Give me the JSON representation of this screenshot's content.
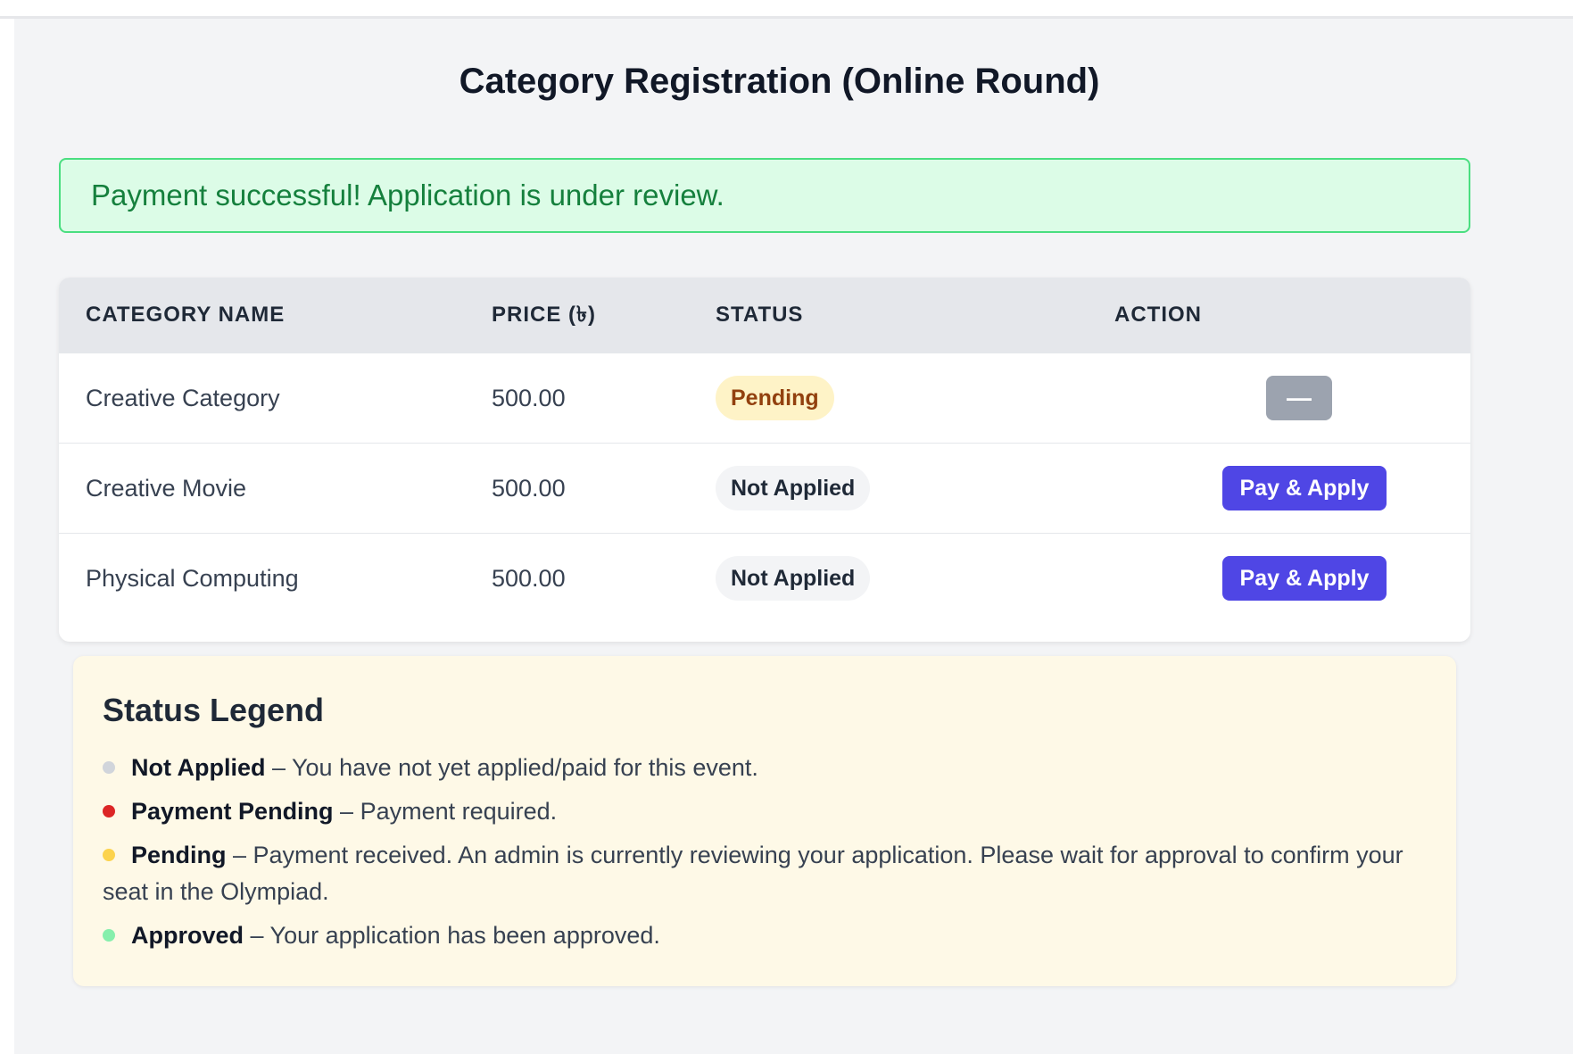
{
  "page": {
    "title": "Category Registration (Online Round)"
  },
  "alert": {
    "message": "Payment successful! Application is under review."
  },
  "table": {
    "headers": {
      "category_name": "CATEGORY NAME",
      "price": "PRICE (৳)",
      "status": "STATUS",
      "action": "ACTION"
    },
    "rows": [
      {
        "category": "Creative Category",
        "price": "500.00",
        "status": "Pending",
        "action": "—"
      },
      {
        "category": "Creative Movie",
        "price": "500.00",
        "status": "Not Applied",
        "action": "Pay & Apply"
      },
      {
        "category": "Physical Computing",
        "price": "500.00",
        "status": "Not Applied",
        "action": "Pay & Apply"
      }
    ]
  },
  "legend": {
    "title": "Status Legend",
    "items": [
      {
        "label": "Not Applied",
        "description": " – You have not yet applied/paid for this event.",
        "color": "#d1d5db"
      },
      {
        "label": "Payment Pending",
        "description": " – Payment required.",
        "color": "#dc2626"
      },
      {
        "label": "Pending",
        "description": " – Payment received. An admin is currently reviewing your application. Please wait for approval to confirm your seat in the Olympiad.",
        "color": "#fcd34d"
      },
      {
        "label": "Approved",
        "description": " – Your application has been approved.",
        "color": "#86efac"
      }
    ]
  },
  "colors": {
    "accent": "#4f46e5",
    "success_bg": "#dcfce7",
    "success_text": "#15803d",
    "pending_bg": "#fef3c7",
    "legend_bg": "#fef9e7"
  }
}
